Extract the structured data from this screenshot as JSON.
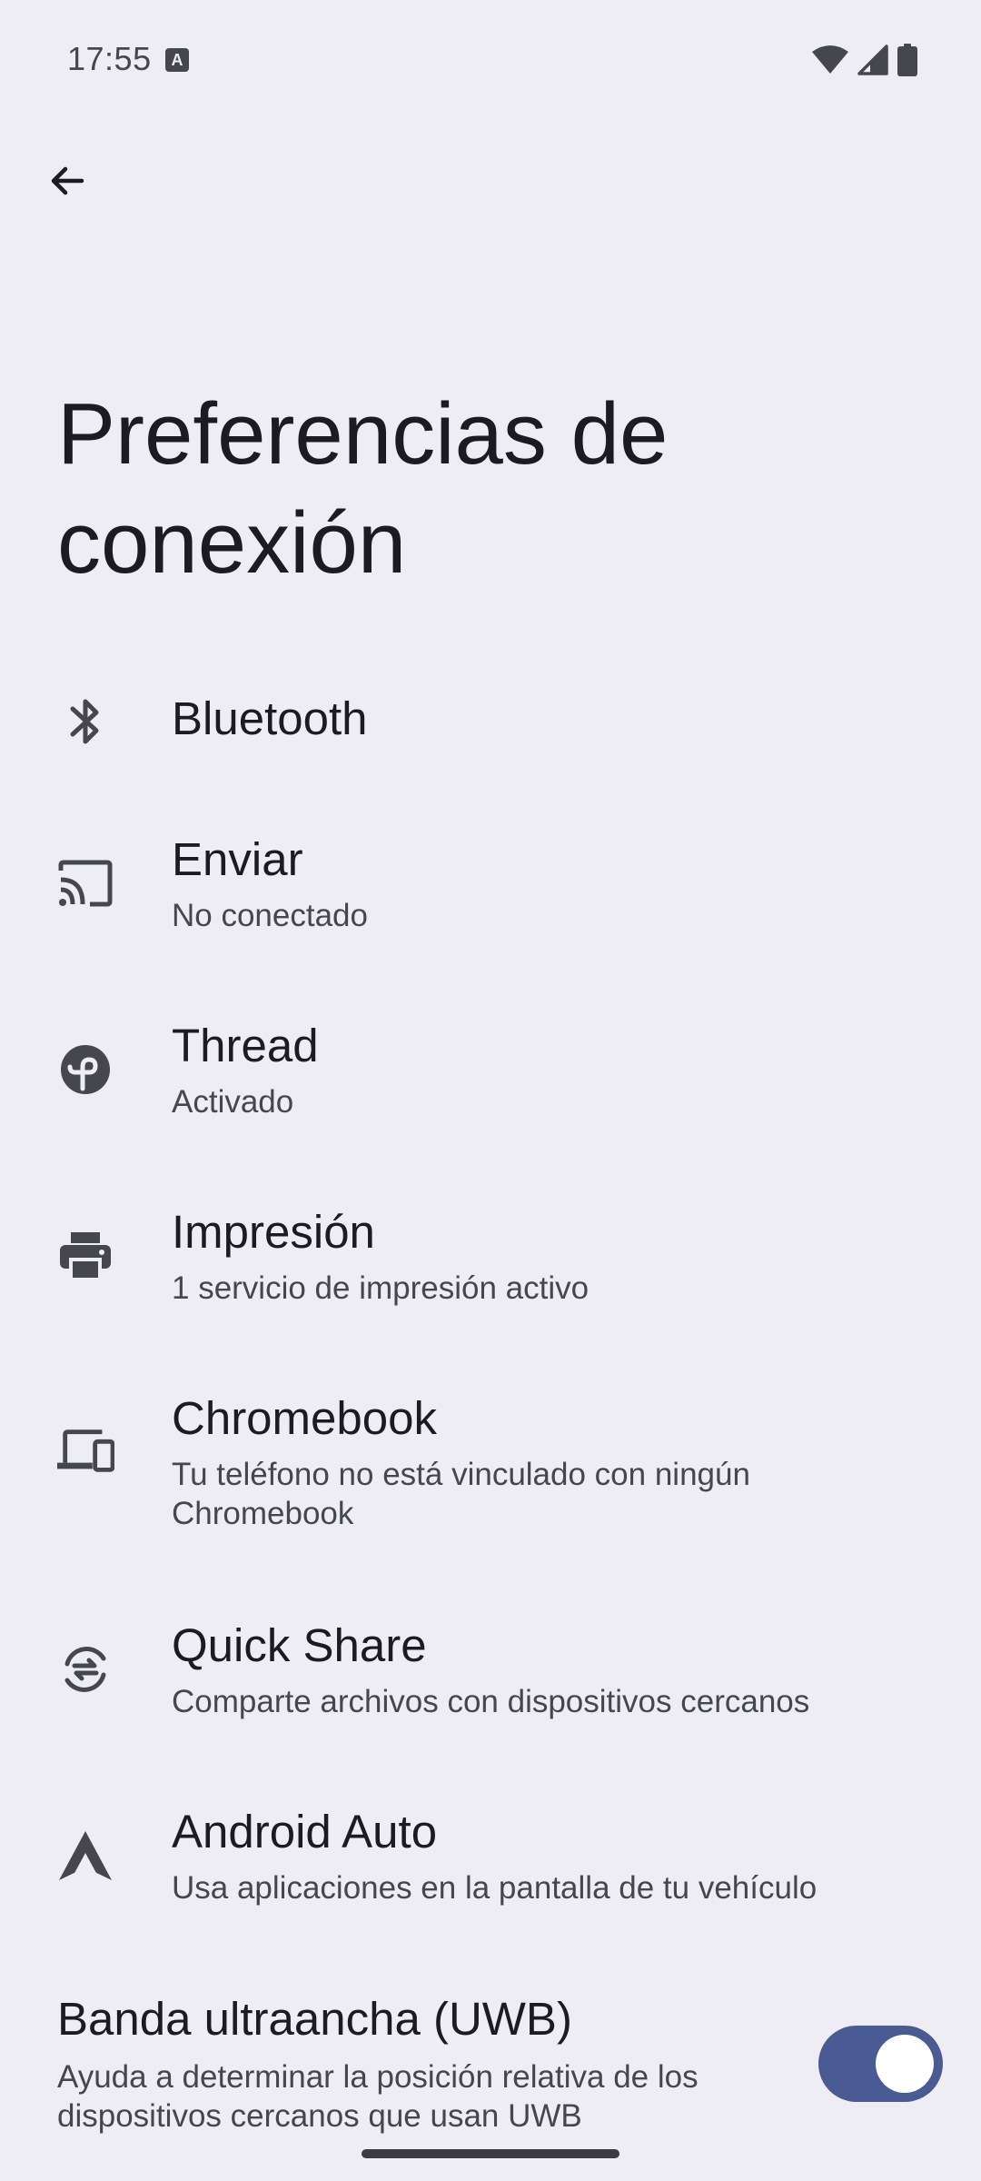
{
  "status_bar": {
    "time": "17:55",
    "app_icon_letter": "A",
    "icons": [
      "wifi-icon",
      "signal-icon",
      "battery-icon"
    ]
  },
  "header": {
    "back_icon": "arrow-back-icon",
    "title": "Preferencias de conexión"
  },
  "items": [
    {
      "icon": "bluetooth-icon",
      "title": "Bluetooth",
      "summary": ""
    },
    {
      "icon": "cast-icon",
      "title": "Enviar",
      "summary": "No conectado"
    },
    {
      "icon": "thread-icon",
      "title": "Thread",
      "summary": "Activado"
    },
    {
      "icon": "print-icon",
      "title": "Impresión",
      "summary": "1 servicio de impresión activo"
    },
    {
      "icon": "chromebook-icon",
      "title": "Chromebook",
      "summary": "Tu teléfono no está vinculado con ningún Chromebook"
    },
    {
      "icon": "quick-share-icon",
      "title": "Quick Share",
      "summary": "Comparte archivos con dispositivos cercanos"
    },
    {
      "icon": "android-auto-icon",
      "title": "Android Auto",
      "summary": "Usa aplicaciones en la pantalla de tu vehículo"
    }
  ],
  "uwb": {
    "title": "Banda ultraancha (UWB)",
    "summary": "Ayuda a determinar la posición relativa de los dispositivos cercanos que usan UWB",
    "enabled": true
  },
  "colors": {
    "background": "#eeedf4",
    "toggle_track": "#4a5a92",
    "icon": "#46464f"
  }
}
